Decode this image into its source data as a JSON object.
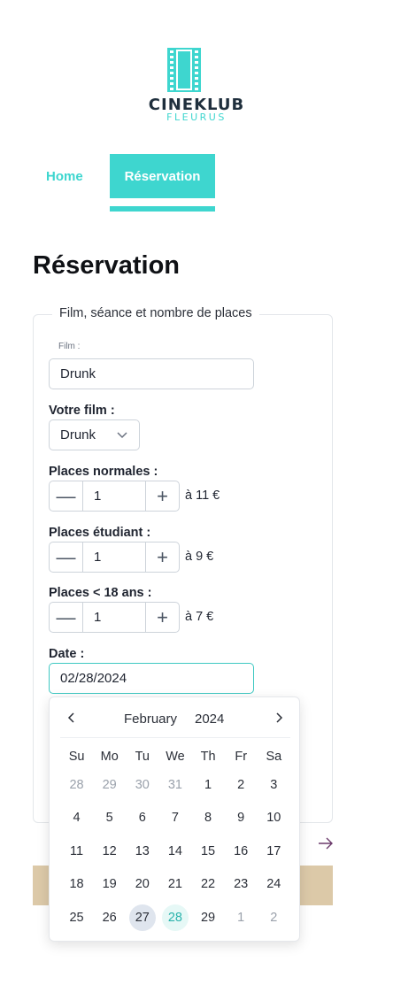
{
  "brand": {
    "name": "CINEKLUB",
    "sub": "FLEURUS",
    "accent": "#3ed6cf"
  },
  "nav": {
    "home": "Home",
    "reservation": "Réservation"
  },
  "page_title": "Réservation",
  "form": {
    "legend": "Film, séance et nombre de places",
    "film_small_label": "Film :",
    "film_value": "Drunk",
    "votre_film_label": "Votre film :",
    "votre_film_value": "Drunk",
    "places_normales_label": "Places normales :",
    "places_normales_value": "1",
    "places_normales_price": "à 11 €",
    "places_etudiant_label": "Places étudiant :",
    "places_etudiant_value": "1",
    "places_etudiant_price": "à 9 €",
    "places_moins18_label": "Places < 18 ans :",
    "places_moins18_value": "1",
    "places_moins18_price": "à 7 €",
    "date_label": "Date :",
    "date_value": "02/28/2024",
    "minus": "—",
    "plus": "+"
  },
  "calendar": {
    "month": "February",
    "year": "2024",
    "weekdays": [
      "Su",
      "Mo",
      "Tu",
      "We",
      "Th",
      "Fr",
      "Sa"
    ],
    "days": [
      [
        "28",
        "29",
        "30",
        "31",
        "1",
        "2",
        "3"
      ],
      [
        "4",
        "5",
        "6",
        "7",
        "8",
        "9",
        "10"
      ],
      [
        "11",
        "12",
        "13",
        "14",
        "15",
        "16",
        "17"
      ],
      [
        "18",
        "19",
        "20",
        "21",
        "22",
        "23",
        "24"
      ],
      [
        "25",
        "26",
        "27",
        "28",
        "29",
        "1",
        "2"
      ]
    ],
    "today": "27",
    "selected": "28"
  }
}
